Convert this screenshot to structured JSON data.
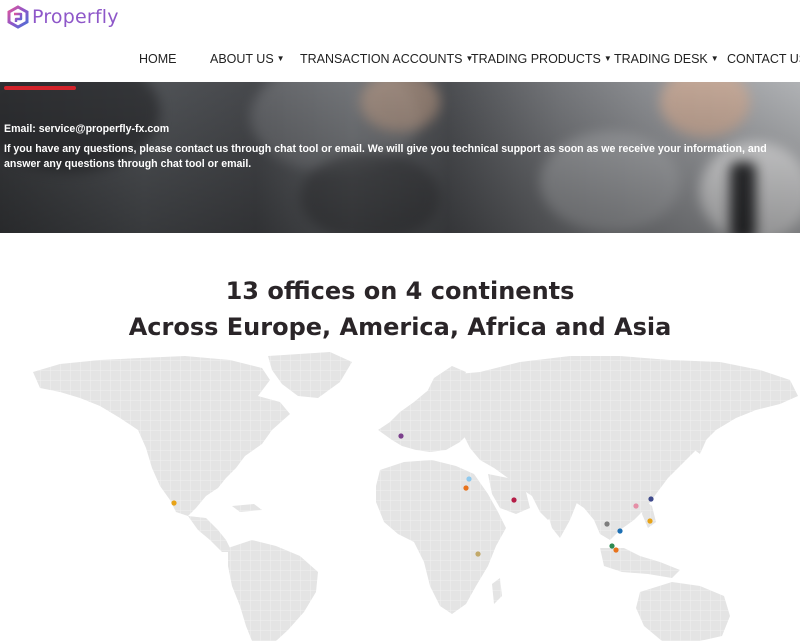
{
  "brand": {
    "name": "Properfly",
    "color": "#8e57c9"
  },
  "nav": {
    "items": [
      {
        "label": "HOME",
        "has_dropdown": false
      },
      {
        "label": "ABOUT US",
        "has_dropdown": true
      },
      {
        "label": "TRANSACTION ACCOUNTS",
        "has_dropdown": true
      },
      {
        "label": "TRADING PRODUCTS",
        "has_dropdown": true
      },
      {
        "label": "TRADING DESK",
        "has_dropdown": true
      },
      {
        "label": "CONTACT US",
        "has_dropdown": true
      }
    ]
  },
  "hero": {
    "email": "Email: service@properfly-fx.com",
    "description": "If you have any questions, please contact us through chat tool or email. We will give you technical support as soon as we receive your information, and answer any questions through chat tool or email.",
    "accent_color": "#d3232b"
  },
  "offices": {
    "heading": "13 offices on 4 continents",
    "subheading": "Across Europe, America, Africa and Asia",
    "markers": [
      {
        "region": "United Kingdom",
        "color": "#7b3f8c"
      },
      {
        "region": "Mexico",
        "color": "#e8a317"
      },
      {
        "region": "Cyprus",
        "color": "#8ec9ee"
      },
      {
        "region": "Egypt",
        "color": "#e8731d"
      },
      {
        "region": "United Arab Emirates",
        "color": "#b51d47"
      },
      {
        "region": "Kenya",
        "color": "#c2a96a"
      },
      {
        "region": "Taiwan",
        "color": "#3f4a8c"
      },
      {
        "region": "Hong Kong",
        "color": "#e58fa7"
      },
      {
        "region": "Philippines",
        "color": "#e8a317"
      },
      {
        "region": "Thailand",
        "color": "#7d7d7d"
      },
      {
        "region": "Vietnam",
        "color": "#1c6fb4"
      },
      {
        "region": "Malaysia",
        "color": "#2e8a52"
      },
      {
        "region": "Singapore",
        "color": "#e8731d"
      }
    ]
  }
}
